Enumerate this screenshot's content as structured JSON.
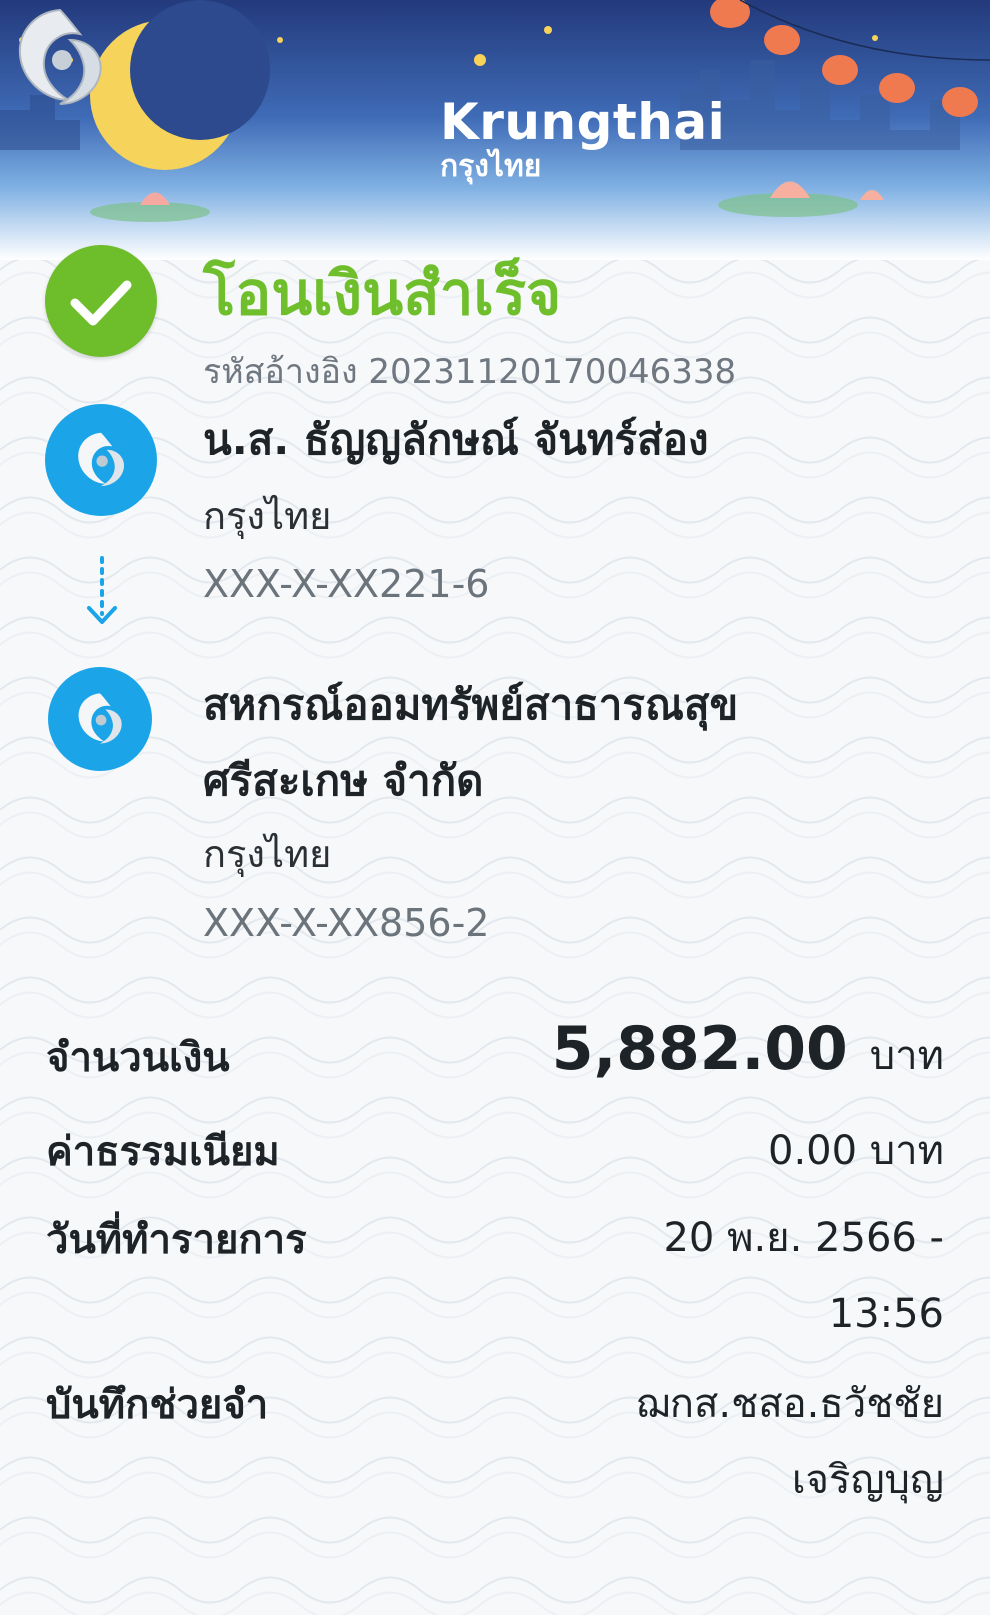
{
  "banner": {
    "brand_en": "Krungthai",
    "brand_th": "กรุงไทย"
  },
  "status": {
    "title": "โอนเงินสำเร็จ",
    "reference_label": "รหัสอ้างอิง",
    "reference_no": "20231120170046338",
    "color": "#6ebd2b"
  },
  "sender": {
    "name": "น.ส. ธัญญลักษณ์ จันทร์ส่อง",
    "bank": "กรุงไทย",
    "account": "XXX-X-XX221-6"
  },
  "receiver": {
    "name_line1": "สหกรณ์ออมทรัพย์สาธารณสุข",
    "name_line2": "ศรีสะเกษ จำกัด",
    "bank": "กรุงไทย",
    "account": "XXX-X-XX856-2"
  },
  "details": {
    "amount_label": "จำนวนเงิน",
    "amount": "5,882.00",
    "currency": "บาท",
    "fee_label": "ค่าธรรมเนียม",
    "fee": "0.00 บาท",
    "date_label": "วันที่ทำรายการ",
    "date_line1": "20 พ.ย. 2566 -",
    "date_line2": "13:56",
    "memo_label": "บันทึกช่วยจำ",
    "memo_line1": "ฌกส.ชสอ.ธวัชชัย",
    "memo_line2": "เจริญบุญ"
  },
  "icons": {
    "status": "check-icon",
    "party": "krungthai-logo-icon",
    "transfer": "dotted-arrow-down-icon"
  },
  "colors": {
    "brand_blue": "#1ba5e8",
    "success_green": "#6ebd2b"
  }
}
